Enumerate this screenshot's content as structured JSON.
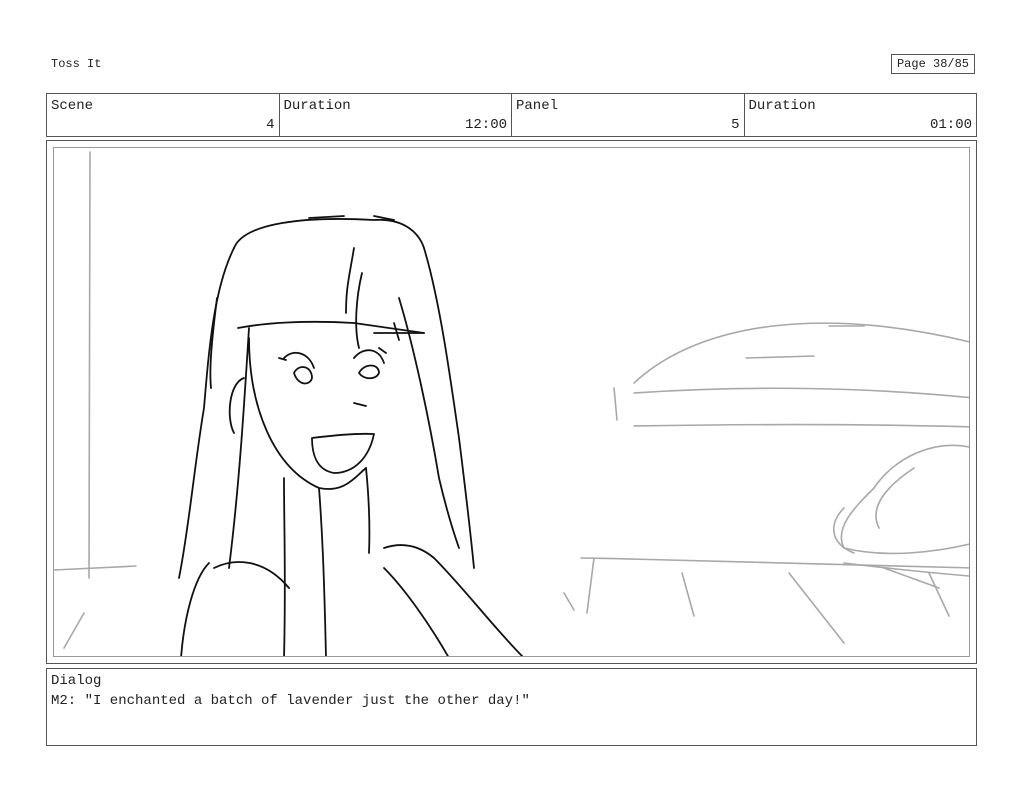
{
  "project_title": "Toss It",
  "page": "Page 38/85",
  "info": {
    "scene_label": "Scene",
    "scene_value": "4",
    "scene_duration_label": "Duration",
    "scene_duration_value": "12:00",
    "panel_label": "Panel",
    "panel_value": "5",
    "panel_duration_label": "Duration",
    "panel_duration_value": "01:00"
  },
  "dialog": {
    "label": "Dialog",
    "text": "M2: \"I enchanted a batch of lavender just the other day!\""
  }
}
